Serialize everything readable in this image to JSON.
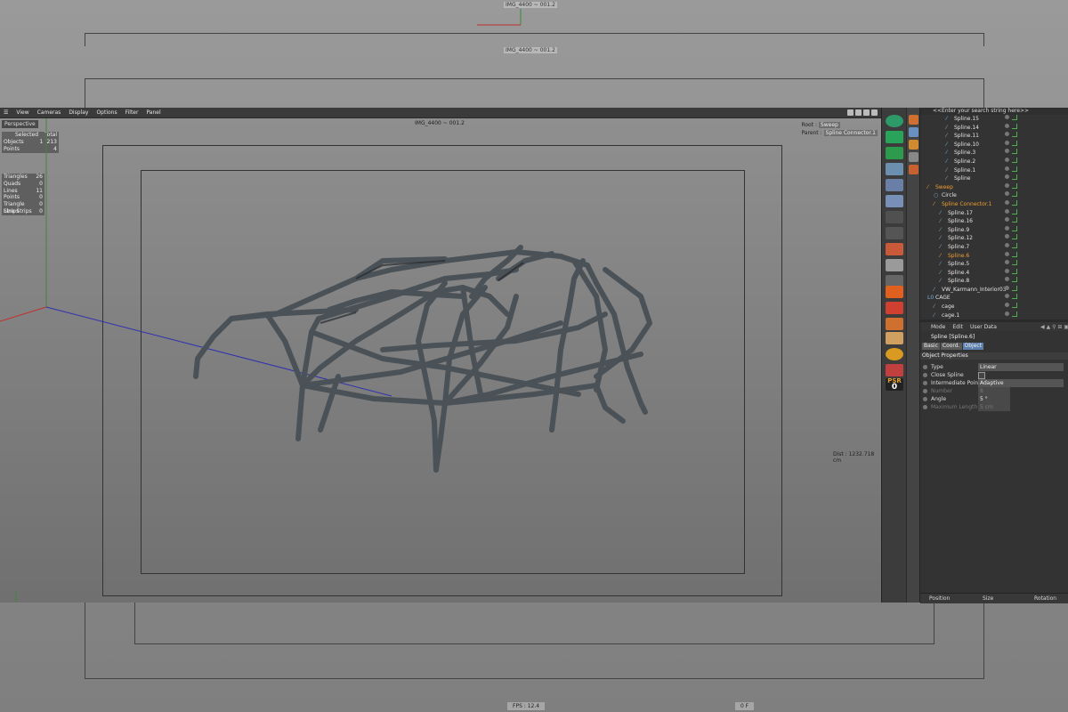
{
  "background": {
    "title_top": "IMG_4400 ~ 001.2",
    "title_mid": "IMG_4400 ~ 001.2",
    "fps": "FPS : 12.4",
    "frame": "0 F"
  },
  "menu": [
    "View",
    "Cameras",
    "Display",
    "Options",
    "Filter",
    "Panel"
  ],
  "viewport": {
    "label": "Perspective",
    "title": "IMG_4400 ~ 001.2",
    "stats_header": {
      "c2": "Selected",
      "c3": "Total"
    },
    "stats": [
      {
        "name": "Objects",
        "sel": "1",
        "total": "213"
      },
      {
        "name": "Points",
        "sel": "",
        "total": "4"
      }
    ],
    "stats2": [
      {
        "name": "Triangles",
        "val": "26"
      },
      {
        "name": "Quads",
        "val": "0"
      },
      {
        "name": "Lines",
        "val": "11"
      },
      {
        "name": "Points",
        "val": "0"
      },
      {
        "name": "Triangle Strips",
        "val": "0"
      },
      {
        "name": "Line Strips",
        "val": "0"
      }
    ],
    "root_label": "Root :",
    "root_value": "Sweep",
    "parent_label": "Parent :",
    "parent_value": "Spline Connector.1",
    "distance": "Dist : 1232.718 cm"
  },
  "object_manager": {
    "search_placeholder": "<<Enter your search string here>>",
    "items": [
      {
        "name": "Spline.15",
        "indent": 3,
        "icon": "spline-icon"
      },
      {
        "name": "Spline.14",
        "indent": 3,
        "icon": "spline-icon"
      },
      {
        "name": "Spline.11",
        "indent": 3,
        "icon": "spline-icon"
      },
      {
        "name": "Spline.10",
        "indent": 3,
        "icon": "spline-icon"
      },
      {
        "name": "Spline.3",
        "indent": 3,
        "icon": "spline-icon"
      },
      {
        "name": "Spline.2",
        "indent": 3,
        "icon": "spline-icon"
      },
      {
        "name": "Spline.1",
        "indent": 3,
        "icon": "spline-icon"
      },
      {
        "name": "Spline",
        "indent": 3,
        "icon": "spline-icon"
      },
      {
        "name": "Sweep",
        "indent": 0,
        "icon": "sweep-icon",
        "active": true
      },
      {
        "name": "Circle",
        "indent": 1,
        "icon": "circle-icon"
      },
      {
        "name": "Spline Connector.1",
        "indent": 1,
        "icon": "connector-icon",
        "active": true
      },
      {
        "name": "Spline.17",
        "indent": 2,
        "icon": "spline-icon"
      },
      {
        "name": "Spline.16",
        "indent": 2,
        "icon": "spline-icon"
      },
      {
        "name": "Spline.9",
        "indent": 2,
        "icon": "spline-icon"
      },
      {
        "name": "Spline.12",
        "indent": 2,
        "icon": "spline-icon"
      },
      {
        "name": "Spline.7",
        "indent": 2,
        "icon": "spline-icon"
      },
      {
        "name": "Spline.6",
        "indent": 2,
        "icon": "spline-icon",
        "active": true
      },
      {
        "name": "Spline.5",
        "indent": 2,
        "icon": "spline-icon"
      },
      {
        "name": "Spline.4",
        "indent": 2,
        "icon": "spline-icon"
      },
      {
        "name": "Spline.8",
        "indent": 2,
        "icon": "spline-icon"
      },
      {
        "name": "VW_Karmann_Interior03",
        "indent": 1,
        "icon": "mesh-icon"
      },
      {
        "name": "CAGE",
        "indent": 0,
        "icon": "null-icon"
      },
      {
        "name": "cage",
        "indent": 1,
        "icon": "mesh-icon"
      },
      {
        "name": "cage.1",
        "indent": 1,
        "icon": "mesh-icon"
      }
    ]
  },
  "attributes": {
    "menu": [
      "Mode",
      "Edit",
      "User Data"
    ],
    "object_name": "Spline [Spline.6]",
    "tabs": [
      "Basic",
      "Coord.",
      "Object"
    ],
    "active_tab": "Object",
    "section": "Object Properties",
    "props": [
      {
        "label": "Type",
        "value": "Linear",
        "enabled": true
      },
      {
        "label": "Close Spline",
        "value": "",
        "enabled": true
      },
      {
        "label": "Intermediate Points",
        "value": "Adaptive",
        "enabled": true
      },
      {
        "label": "Number",
        "value": "8",
        "enabled": false
      },
      {
        "label": "Angle",
        "value": "5 °",
        "enabled": true
      },
      {
        "label": "Maximum Length",
        "value": "5 cm",
        "enabled": false
      }
    ],
    "coord_headers": [
      "Position",
      "Size",
      "Rotation"
    ]
  },
  "colors": {
    "accent_orange": "#f0a030",
    "selection_blue": "#5c7fae",
    "cage_tube": "#4a5258"
  }
}
